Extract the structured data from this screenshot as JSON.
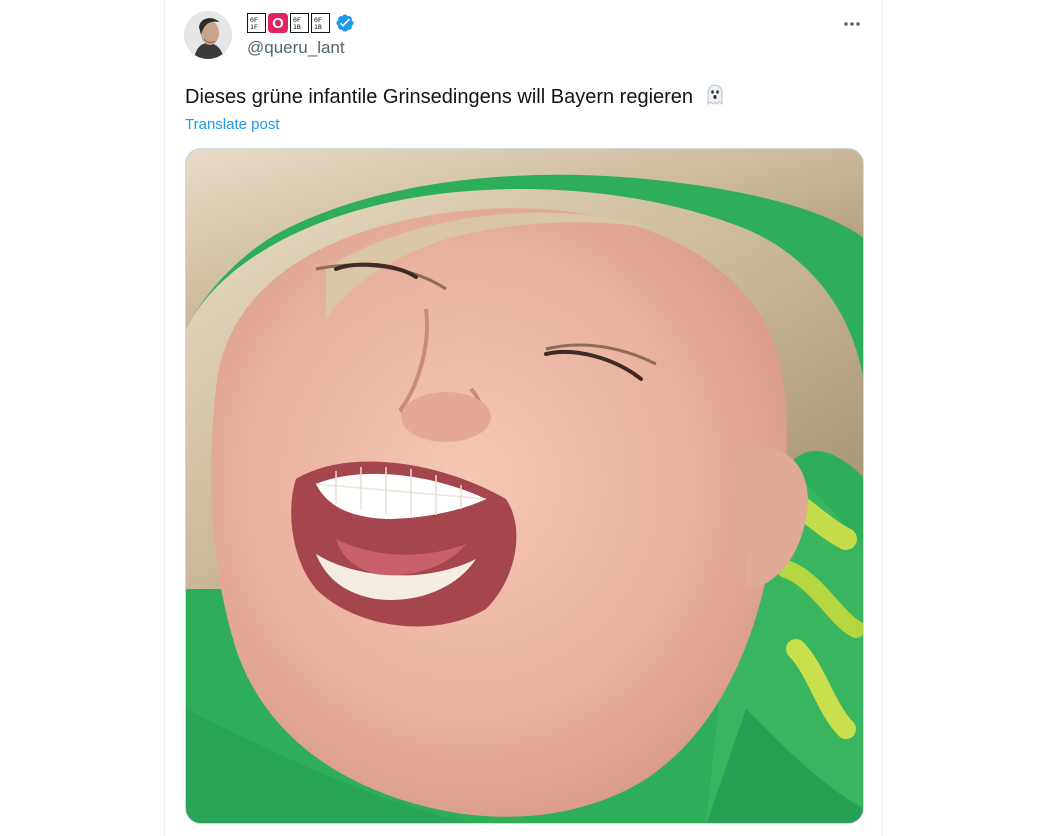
{
  "post": {
    "display_name_badge": "O",
    "display_name_glyphs": [
      "0F\n1F​",
      "0F\n1F",
      "0F\n1F"
    ],
    "handle": "@queru_lant",
    "text": "Dieses grüne infantile Grinsedingens will Bayern regieren",
    "translate_label": "Translate post",
    "verified": true
  },
  "icons": {
    "verified": "verified-badge-icon",
    "more": "more-options-icon",
    "emoji": "ghost-emoji-icon"
  },
  "colors": {
    "text_primary": "#0f1419",
    "text_secondary": "#536471",
    "link": "#1d9bf0",
    "badge_red": "#e0245e",
    "verified_blue": "#1d9bf0",
    "photo_background_green": "#2fae5a"
  }
}
